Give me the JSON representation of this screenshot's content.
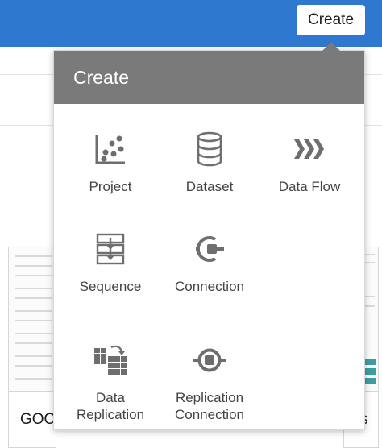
{
  "header": {
    "create_button_label": "Create"
  },
  "background": {
    "card_left_title": "GOO",
    "card_right_title": "is"
  },
  "menu": {
    "title": "Create",
    "items": [
      {
        "label": "Project",
        "icon": "project-icon"
      },
      {
        "label": "Dataset",
        "icon": "dataset-icon"
      },
      {
        "label": "Data Flow",
        "icon": "data-flow-icon"
      },
      {
        "label": "Sequence",
        "icon": "sequence-icon"
      },
      {
        "label": "Connection",
        "icon": "connection-icon"
      }
    ],
    "replication_items": [
      {
        "label_line1": "Data",
        "label_line2": "Replication",
        "icon": "data-replication-icon"
      },
      {
        "label_line1": "Replication",
        "label_line2": "Connection",
        "icon": "replication-connection-icon"
      }
    ]
  },
  "colors": {
    "topbar": "#2f78cf",
    "menu_header": "#7a7a7a",
    "icon": "#6e6e6e",
    "text": "#444444"
  }
}
